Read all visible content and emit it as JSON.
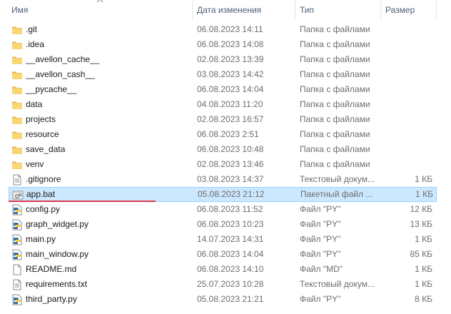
{
  "columns": {
    "name": "Имя",
    "date": "Дата изменения",
    "type": "Тип",
    "size": "Размер"
  },
  "files": [
    {
      "name": ".git",
      "date": "06.08.2023 14:11",
      "type": "Папка с файлами",
      "size": "",
      "icon": "folder-icon"
    },
    {
      "name": ".idea",
      "date": "06.08.2023 14:08",
      "type": "Папка с файлами",
      "size": "",
      "icon": "folder-icon"
    },
    {
      "name": "__avellon_cache__",
      "date": "02.08.2023 13:39",
      "type": "Папка с файлами",
      "size": "",
      "icon": "folder-icon"
    },
    {
      "name": "__avellon_cash__",
      "date": "03.08.2023 14:42",
      "type": "Папка с файлами",
      "size": "",
      "icon": "folder-icon"
    },
    {
      "name": "__pycache__",
      "date": "06.08.2023 14:04",
      "type": "Папка с файлами",
      "size": "",
      "icon": "folder-icon"
    },
    {
      "name": "data",
      "date": "04.08.2023 11:20",
      "type": "Папка с файлами",
      "size": "",
      "icon": "folder-icon"
    },
    {
      "name": "projects",
      "date": "02.08.2023 16:57",
      "type": "Папка с файлами",
      "size": "",
      "icon": "folder-icon"
    },
    {
      "name": "resource",
      "date": "06.08.2023 2:51",
      "type": "Папка с файлами",
      "size": "",
      "icon": "folder-icon"
    },
    {
      "name": "save_data",
      "date": "06.08.2023 10:48",
      "type": "Папка с файлами",
      "size": "",
      "icon": "folder-icon"
    },
    {
      "name": "venv",
      "date": "02.08.2023 13:46",
      "type": "Папка с файлами",
      "size": "",
      "icon": "folder-icon"
    },
    {
      "name": ".gitignore",
      "date": "03.08.2023 14:37",
      "type": "Текстовый докум...",
      "size": "1 КБ",
      "icon": "text-file-icon"
    },
    {
      "name": "app.bat",
      "date": "05.08.2023 21:12",
      "type": "Пакетный файл ...",
      "size": "1 КБ",
      "icon": "batch-file-icon",
      "selected": true
    },
    {
      "name": "config.py",
      "date": "06.08.2023 11:52",
      "type": "Файл \"PY\"",
      "size": "12 КБ",
      "icon": "python-file-icon"
    },
    {
      "name": "graph_widget.py",
      "date": "06.08.2023 10:23",
      "type": "Файл \"PY\"",
      "size": "13 КБ",
      "icon": "python-file-icon"
    },
    {
      "name": "main.py",
      "date": "14.07.2023 14:31",
      "type": "Файл \"PY\"",
      "size": "1 КБ",
      "icon": "python-file-icon"
    },
    {
      "name": "main_window.py",
      "date": "06.08.2023 14:04",
      "type": "Файл \"PY\"",
      "size": "85 КБ",
      "icon": "python-file-icon"
    },
    {
      "name": "README.md",
      "date": "06.08.2023 14:10",
      "type": "Файл \"MD\"",
      "size": "1 КБ",
      "icon": "blank-file-icon"
    },
    {
      "name": "requirements.txt",
      "date": "25.07.2023 10:28",
      "type": "Текстовый докум...",
      "size": "1 КБ",
      "icon": "text-file-icon"
    },
    {
      "name": "third_party.py",
      "date": "05.08.2023 21:21",
      "type": "Файл \"PY\"",
      "size": "8 КБ",
      "icon": "python-file-icon"
    }
  ],
  "colors": {
    "selection_bg": "#cce8ff",
    "selection_border": "#99d1ff",
    "header_text": "#4c607a",
    "annotation_underline": "#d9394b",
    "folder": "#f8d775"
  }
}
